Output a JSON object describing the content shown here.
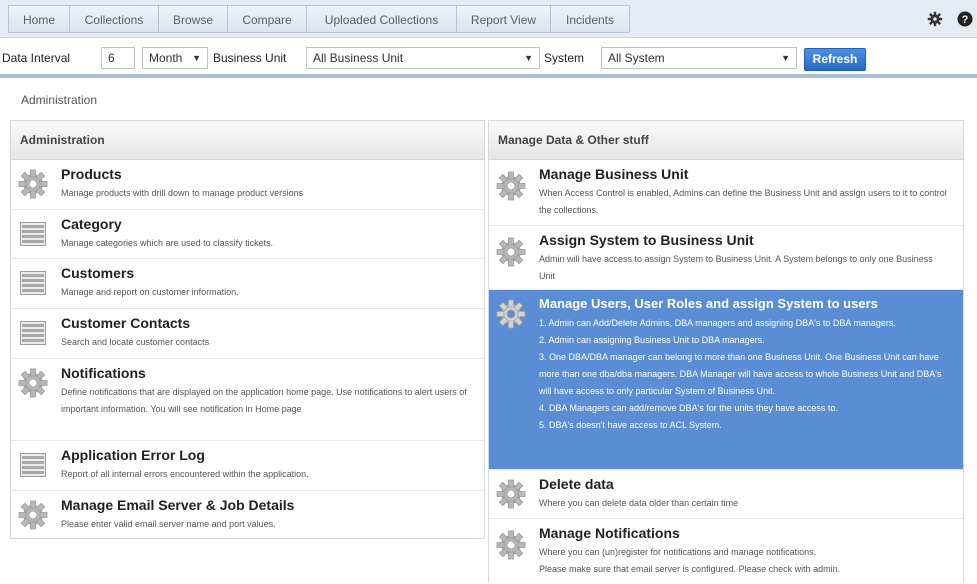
{
  "nav": {
    "tabs": [
      "Home",
      "Collections",
      "Browse",
      "Compare",
      "Uploaded Collections",
      "Report View",
      "Incidents"
    ],
    "icons": [
      "gear-icon",
      "help-icon"
    ]
  },
  "filters": {
    "interval_label": "Data Interval",
    "interval_value": "6",
    "interval_unit": "Month",
    "business_unit_label": "Business Unit",
    "business_unit_value": "All Business Unit",
    "system_label": "System",
    "system_value": "All System",
    "refresh_label": "Refresh"
  },
  "breadcrumb": "Administration",
  "left_panel": {
    "title": "Administration",
    "items": [
      {
        "title": "Products",
        "desc": "Manage products with drill down to manage product versions",
        "icon": "gear-icon"
      },
      {
        "title": "Category",
        "desc": "Manage categories which are used to classify tickets.",
        "icon": "list-icon"
      },
      {
        "title": "Customers",
        "desc": "Manage and report on customer information.",
        "icon": "list-icon"
      },
      {
        "title": "Customer Contacts",
        "desc": "Search and locate customer contacts",
        "icon": "list-icon"
      },
      {
        "title": "Notifications",
        "desc": "Define notifications that are displayed on the application home page. Use notifications to alert users of important information. You will see notification in Home page",
        "icon": "gear-icon"
      },
      {
        "title": "Application Error Log",
        "desc": "Report of all internal errors encountered within the application.",
        "icon": "list-icon"
      },
      {
        "title": "Manage Email Server & Job Details",
        "desc": "Please enter valid email server name and port values.",
        "icon": "gear-icon"
      }
    ]
  },
  "right_panel": {
    "title": "Manage Data & Other stuff",
    "items": [
      {
        "title": "Manage Business Unit",
        "desc": "When Access Control is enabled, Admins can define the Business Unit and assign users to it to control the collections.",
        "icon": "gear-icon"
      },
      {
        "title": "Assign System to Business Unit",
        "desc": "Admin will have access to assign System to Business Unit. A System belongs to only one Business Unit",
        "icon": "gear-icon"
      },
      {
        "title": "Manage Users, User Roles and assign System to users",
        "desc_lines": [
          "1. Admin can Add/Delete Admins, DBA managers and assigning DBA's to DBA managers.",
          "2. Admin can assigning Business Unit to DBA managers.",
          "3. One DBA/DBA manager can belong to more than one Business Unit. One Business Unit can have more than one dba/dba managers. DBA Manager will have access to whole Business Unit and DBA's will have access to only particular System of Business Unit.",
          "4. DBA Managers can add/remove DBA's for the units they have access to.",
          "5. DBA's doesn't have access to ACL System."
        ],
        "icon": "gear-icon"
      },
      {
        "title": "Delete data",
        "desc": "Where you can delete data older than certain time",
        "icon": "gear-icon"
      },
      {
        "title": "Manage Notifications",
        "desc_lines": [
          "Where you can (un)register for notifications and manage notifications.",
          "Please make sure that email server is configured. Please check with admin."
        ],
        "icon": "gear-icon"
      }
    ]
  }
}
